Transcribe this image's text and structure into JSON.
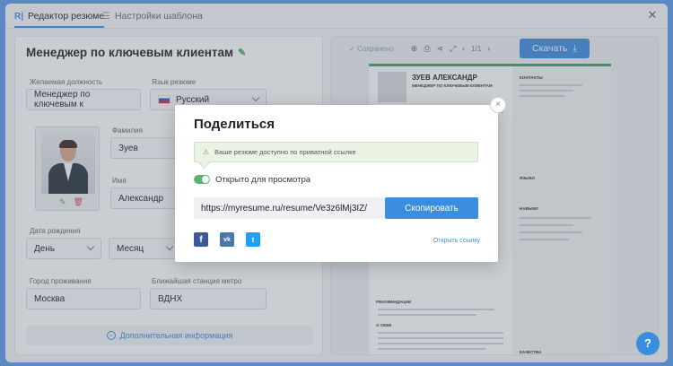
{
  "tabs": [
    {
      "label": "Редактор резюме",
      "icon": "resume-icon",
      "active": true
    },
    {
      "label": "Настройки шаблона",
      "icon": "settings-list-icon",
      "active": false
    }
  ],
  "form": {
    "title": "Менеджер по ключевым клиентам",
    "desired_position_label": "Желаемая должность",
    "desired_position_value": "Менеджер по ключевым к",
    "resume_language_label": "Язык резюме",
    "resume_language_value": "Русский",
    "last_name_label": "Фамилия",
    "last_name_value": "Зуев",
    "first_name_label": "Имя",
    "first_name_value": "Александр",
    "birth_date_label": "Дата рождения",
    "day_value": "День",
    "month_value": "Месяц",
    "city_label": "Город проживания",
    "city_value": "Москва",
    "metro_label": "Ближайшая станция метро",
    "metro_value": "ВДНХ",
    "more_info_label": "Дополнительная информация"
  },
  "preview": {
    "saved_label": "Сохранено",
    "page_indicator": "1/1",
    "download_label": "Скачать",
    "resume_name": "ЗУЕВ АЛЕКСАНДР",
    "resume_position": "МЕНЕДЖЕР ПО КЛЮЧЕВЫМ КЛИЕНТАМ",
    "contacts_heading": "КОНТАКТЫ",
    "languages_heading": "ЯЗЫКИ",
    "skills_heading": "НАВЫКИ",
    "recommendations_heading": "РЕКОМЕНДАЦИИ",
    "about_heading": "О СЕБЕ",
    "qualities_heading": "КАЧЕСТВА"
  },
  "share_modal": {
    "title": "Поделиться",
    "notice": "Ваше резюме доступно по приватной ссылке",
    "toggle_label": "Открыто для просмотра",
    "toggle_on": true,
    "url": "https://myresume.ru/resume/Ve3z6lMj3IZ/",
    "copy_label": "Скопировать",
    "open_link_label": "Открыть ссылку",
    "social": [
      {
        "name": "facebook",
        "glyph": "f"
      },
      {
        "name": "vk",
        "glyph": "vk"
      },
      {
        "name": "twitter",
        "glyph": "t"
      }
    ],
    "close_glyph": "×"
  },
  "help_glyph": "?",
  "colors": {
    "accent": "#3b8de0",
    "toggle_on": "#56b86a",
    "notice_bg": "#eaf3e4",
    "resume_accent": "#3fa36b"
  }
}
